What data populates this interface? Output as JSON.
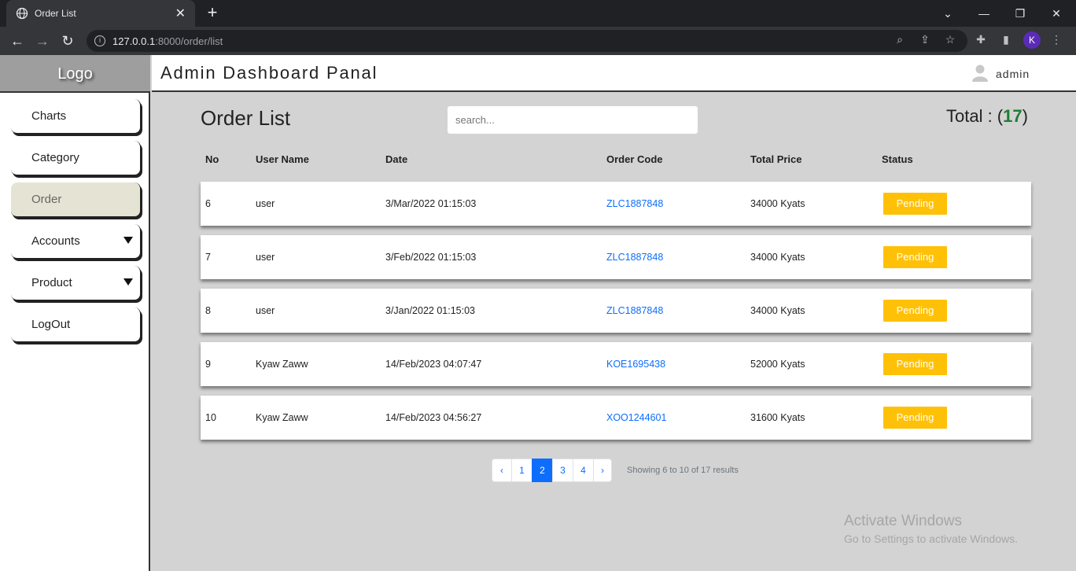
{
  "browser": {
    "tab_title": "Order List",
    "url_host": "127.0.0.1",
    "url_path": ":8000/order/list",
    "profile_initial": "K"
  },
  "sidebar": {
    "logo": "Logo",
    "items": [
      {
        "label": "Charts"
      },
      {
        "label": "Category"
      },
      {
        "label": "Order"
      },
      {
        "label": "Accounts"
      },
      {
        "label": "Product"
      },
      {
        "label": "LogOut"
      }
    ]
  },
  "header": {
    "title": "Admin Dashboard Panal",
    "username": "admin"
  },
  "main": {
    "title": "Order List",
    "search_placeholder": "search...",
    "total_label": "Total : (",
    "total_value": "17",
    "total_close": ")",
    "columns": [
      "No",
      "User Name",
      "Date",
      "Order Code",
      "Total Price",
      "Status"
    ],
    "rows": [
      {
        "no": "6",
        "user": "user",
        "date": "3/Mar/2022 01:15:03",
        "code": "ZLC1887848",
        "price": "34000 Kyats",
        "status": "Pending"
      },
      {
        "no": "7",
        "user": "user",
        "date": "3/Feb/2022 01:15:03",
        "code": "ZLC1887848",
        "price": "34000 Kyats",
        "status": "Pending"
      },
      {
        "no": "8",
        "user": "user",
        "date": "3/Jan/2022 01:15:03",
        "code": "ZLC1887848",
        "price": "34000 Kyats",
        "status": "Pending"
      },
      {
        "no": "9",
        "user": "Kyaw Zaww",
        "date": "14/Feb/2023 04:07:47",
        "code": "KOE1695438",
        "price": "52000 Kyats",
        "status": "Pending"
      },
      {
        "no": "10",
        "user": "Kyaw Zaww",
        "date": "14/Feb/2023 04:56:27",
        "code": "XOO1244601",
        "price": "31600 Kyats",
        "status": "Pending"
      }
    ]
  },
  "pagination": {
    "prev": "‹",
    "pages": [
      "1",
      "2",
      "3",
      "4"
    ],
    "next": "›",
    "current": "2",
    "summary": "Showing 6 to 10 of 17 results"
  },
  "watermark": {
    "line1": "Activate Windows",
    "line2": "Go to Settings to activate Windows."
  },
  "colors": {
    "accent": "#0d6efd",
    "status_pending": "#ffc107",
    "total_green": "#1e7e34"
  }
}
